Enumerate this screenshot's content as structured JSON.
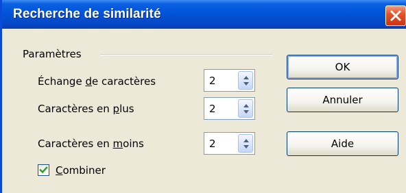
{
  "window": {
    "title": "Recherche de similarité",
    "close_icon": "close-icon"
  },
  "group": {
    "legend": "Paramètres"
  },
  "fields": [
    {
      "label": "Échange de caractères",
      "value": "2"
    },
    {
      "label": "Caractères en plus",
      "value": "2"
    },
    {
      "label": "Caractères en moins",
      "value": "2"
    }
  ],
  "combine": {
    "label": "Combiner",
    "checked": true
  },
  "buttons": {
    "ok": "OK",
    "cancel": "Annuler",
    "help": "Aide"
  },
  "colors": {
    "titlebar": "#0254d9",
    "close": "#e4522c",
    "check": "#21a121"
  }
}
